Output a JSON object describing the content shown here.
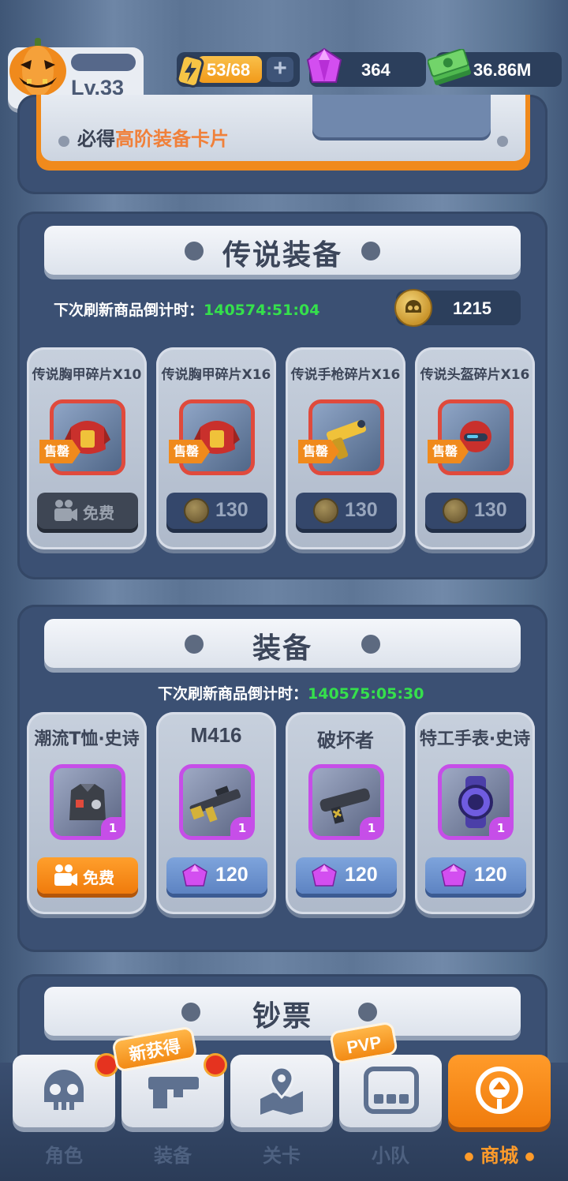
{
  "header": {
    "level": "Lv.33",
    "energy": "53/68",
    "energy_fraction": 0.78,
    "gems": "364",
    "cash": "36.86M"
  },
  "top_banner": {
    "prefix": "必得",
    "highlight": "高阶装备卡片"
  },
  "legendary": {
    "title": "传说装备",
    "countdown_label": "下次刷新商品倒计时：",
    "countdown_value": "140574:51:04",
    "currency_value": "1215",
    "items": [
      {
        "name": "传说胸甲碎片X10",
        "tag": "售罄",
        "action_label": "免费",
        "icon": "red-armor-icon"
      },
      {
        "name": "传说胸甲碎片X16",
        "tag": "售罄",
        "price": "130",
        "icon": "red-armor-icon"
      },
      {
        "name": "传说手枪碎片X16",
        "tag": "售罄",
        "price": "130",
        "icon": "golden-pistol-icon"
      },
      {
        "name": "传说头盔碎片X16",
        "tag": "售罄",
        "price": "130",
        "icon": "red-helmet-icon"
      }
    ]
  },
  "equipment": {
    "title": "装备",
    "countdown_label": "下次刷新商品倒计时：",
    "countdown_value": "140575:05:30",
    "items": [
      {
        "name": "潮流T恤·史诗",
        "count": "1",
        "action_label": "免费",
        "icon": "tshirt-icon"
      },
      {
        "name": "M416",
        "count": "1",
        "price": "120",
        "icon": "rifle-icon"
      },
      {
        "name": "破坏者",
        "count": "1",
        "price": "120",
        "icon": "shotgun-icon"
      },
      {
        "name": "特工手表·史诗",
        "count": "1",
        "price": "120",
        "icon": "watch-icon"
      }
    ]
  },
  "banknote": {
    "title": "钞票"
  },
  "nav": {
    "items": [
      {
        "label": "角色",
        "icon": "skull-icon"
      },
      {
        "label": "装备",
        "icon": "gun-icon",
        "badge": "新获得"
      },
      {
        "label": "关卡",
        "icon": "map-pin-icon"
      },
      {
        "label": "小队",
        "icon": "squad-icon",
        "badge": "PVP"
      },
      {
        "label": "商城",
        "icon": "shop-icon",
        "active": true
      }
    ]
  },
  "colors": {
    "accent_orange": "#f08a1c",
    "timer_green": "#35e04c",
    "legend_red": "#e04a3c",
    "epic_purple": "#c64ee8"
  }
}
